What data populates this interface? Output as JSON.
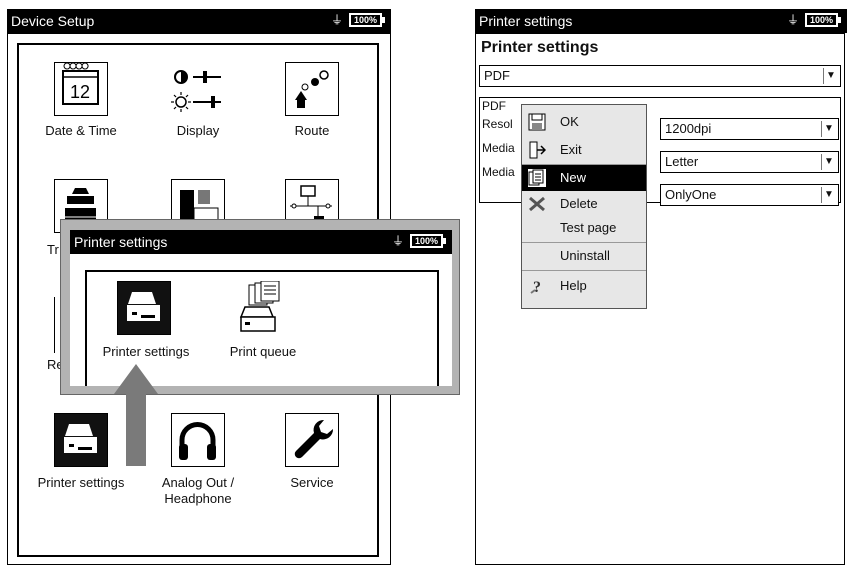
{
  "left": {
    "title": "Device Setup",
    "battery": "100%",
    "icons": [
      {
        "label": "Date & Time"
      },
      {
        "label": "Display"
      },
      {
        "label": "Route"
      },
      {
        "label": "Printer settings"
      },
      {
        "label": "Analog Out / Headphone"
      },
      {
        "label": "Service"
      }
    ],
    "partial_labels": [
      "Tr",
      "Re"
    ],
    "date_icon_day": "12"
  },
  "popup": {
    "title": "Printer settings",
    "battery": "100%",
    "items": [
      {
        "label": "Printer settings"
      },
      {
        "label": "Print queue"
      }
    ]
  },
  "right": {
    "title": "Printer settings",
    "battery": "100%",
    "heading": "Printer settings",
    "printer_select": "PDF",
    "rows": [
      {
        "label": "PDF"
      },
      {
        "label": "Resol",
        "value": "1200dpi"
      },
      {
        "label": "Media",
        "value": "Letter"
      },
      {
        "label": "Media",
        "value": "OnlyOne"
      }
    ],
    "menu": [
      {
        "label": "OK",
        "icon": "save-icon"
      },
      {
        "label": "Exit",
        "icon": "exit-icon"
      },
      {
        "label": "New",
        "icon": "new-document-icon"
      },
      {
        "label": "Delete",
        "icon": "delete-icon"
      },
      {
        "label": "Test page",
        "icon": ""
      },
      {
        "label": "Uninstall",
        "icon": ""
      },
      {
        "label": "Help",
        "icon": "help-icon"
      }
    ]
  },
  "colors": {
    "titlebar": "#000000",
    "popup_frame": "#b3b3b3",
    "arrow": "#7a7a7a",
    "menu_bg": "#e7e7e7"
  }
}
